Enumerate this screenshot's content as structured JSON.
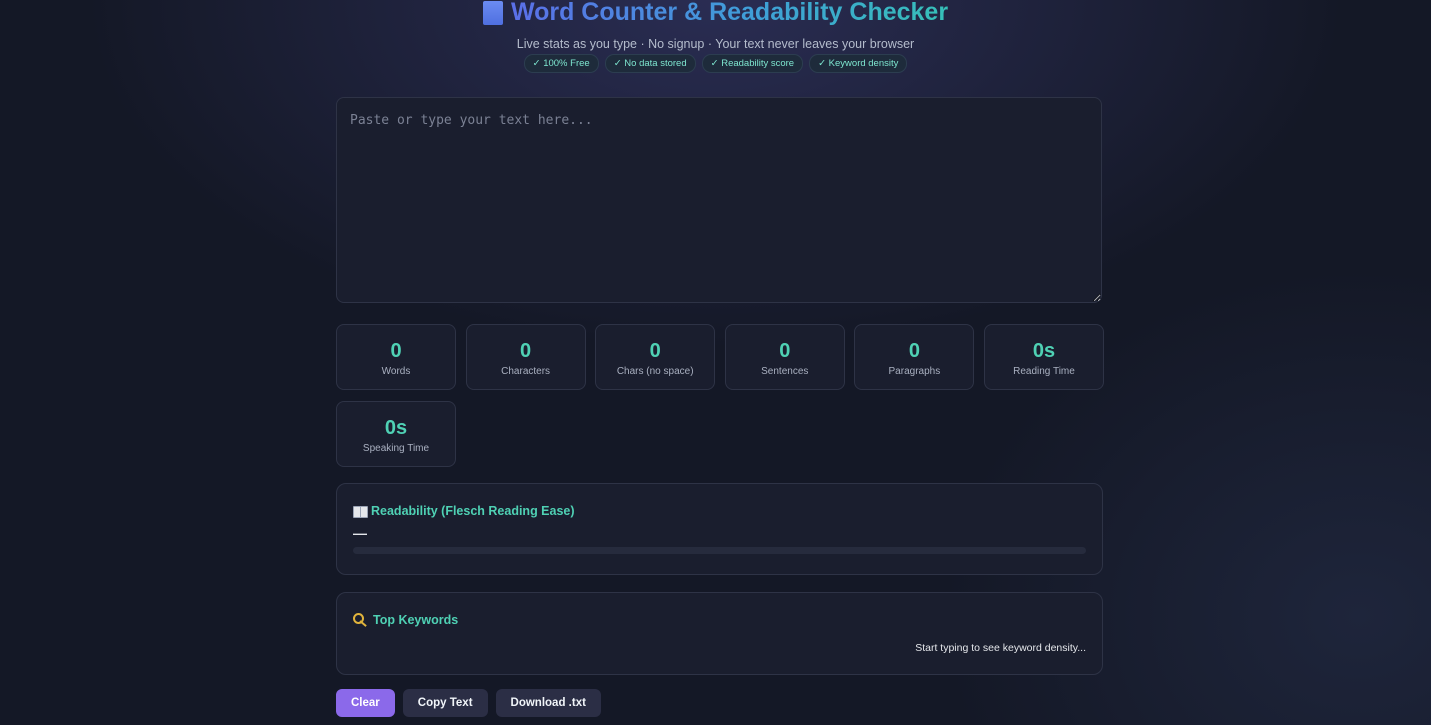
{
  "header": {
    "title_icon": "notebook-icon",
    "title": "Word Counter & Readability Checker",
    "subtitle": "Live stats as you type · No signup · Your text never leaves your browser",
    "badges": [
      "✓ 100% Free",
      "✓ No data stored",
      "✓ Readability score",
      "✓ Keyword density"
    ]
  },
  "editor": {
    "value": "",
    "placeholder": "Paste or type your text here..."
  },
  "stats": [
    {
      "value": "0",
      "label": "Words"
    },
    {
      "value": "0",
      "label": "Characters"
    },
    {
      "value": "0",
      "label": "Chars (no space)"
    },
    {
      "value": "0",
      "label": "Sentences"
    },
    {
      "value": "0",
      "label": "Paragraphs"
    },
    {
      "value": "0s",
      "label": "Reading Time"
    },
    {
      "value": "0s",
      "label": "Speaking Time"
    }
  ],
  "readability": {
    "icon": "open-book-icon",
    "heading": "Readability (Flesch Reading Ease)",
    "score": "—",
    "progress": 0
  },
  "keywords": {
    "icon": "key-icon",
    "heading": "Top Keywords",
    "empty_message": "Start typing to see keyword density..."
  },
  "actions": {
    "clear_label": "Clear",
    "copy_label": "Copy Text",
    "download_label": "Download .txt"
  },
  "colors": {
    "accent": "#4fd1b4",
    "primary_button": "#8b69ea",
    "background": "#141826",
    "card": "#1a1e2e"
  }
}
